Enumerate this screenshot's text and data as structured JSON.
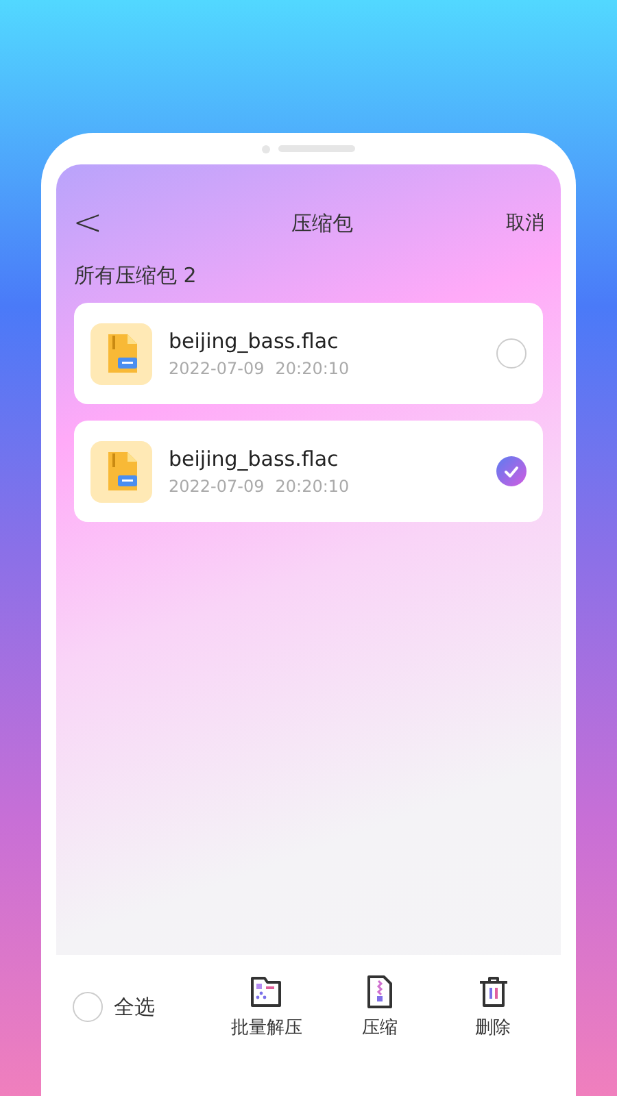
{
  "nav": {
    "back": "<",
    "title": "压缩包",
    "cancel": "取消"
  },
  "list_header": "所有压缩包 2",
  "files": [
    {
      "name": "beijing_bass.flac",
      "date": "2022-07-09",
      "time": "20:20:10",
      "selected": false
    },
    {
      "name": "beijing_bass.flac",
      "date": "2022-07-09",
      "time": "20:20:10",
      "selected": true
    }
  ],
  "bottom_bar": {
    "select_all": {
      "label": "全选",
      "checked": false
    },
    "actions": [
      {
        "kind": "extract",
        "label": "批量解压"
      },
      {
        "kind": "compress",
        "label": "压缩"
      },
      {
        "kind": "delete",
        "label": "删除"
      }
    ]
  }
}
